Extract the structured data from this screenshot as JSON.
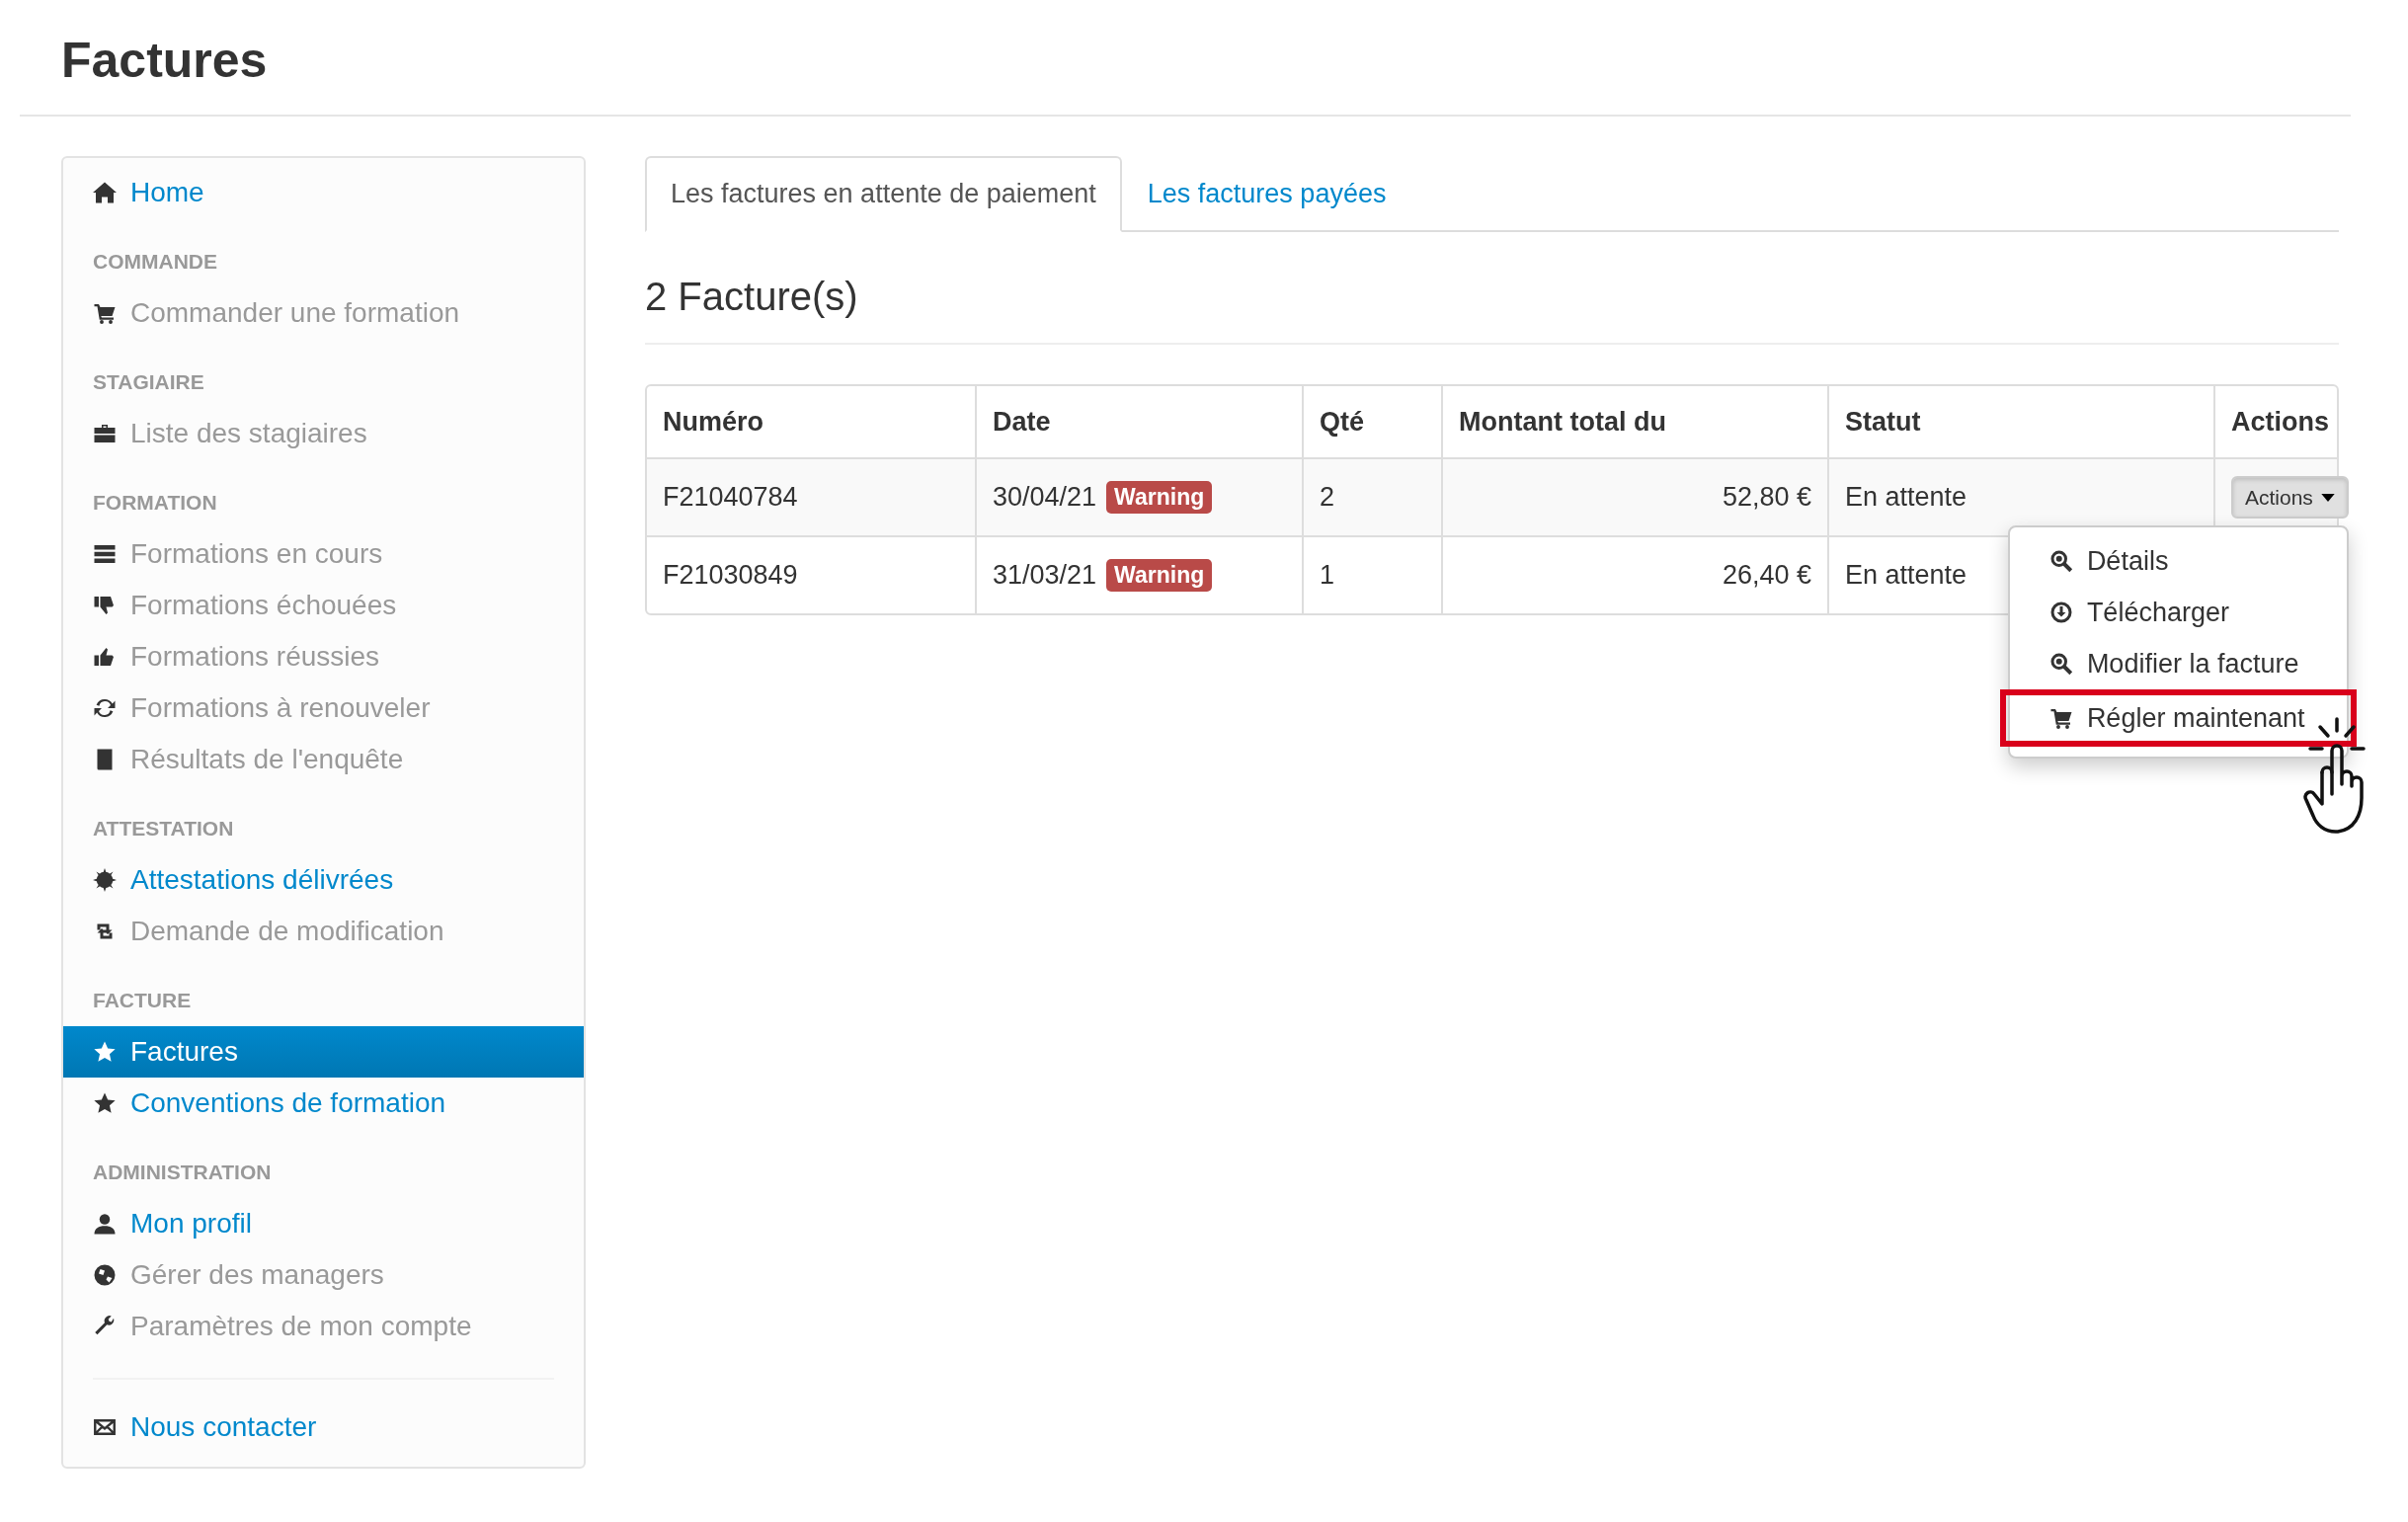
{
  "page": {
    "title": "Factures"
  },
  "sidebar": {
    "groups": [
      {
        "items": [
          {
            "label": "Home",
            "disabled": false,
            "selected": false
          }
        ]
      },
      {
        "heading": "COMMANDE",
        "items": [
          {
            "label": "Commander une formation",
            "disabled": true,
            "selected": false
          }
        ]
      },
      {
        "heading": "STAGIAIRE",
        "items": [
          {
            "label": "Liste des stagiaires",
            "disabled": true,
            "selected": false
          }
        ]
      },
      {
        "heading": "FORMATION",
        "items": [
          {
            "label": "Formations en cours",
            "disabled": true,
            "selected": false
          },
          {
            "label": "Formations échouées",
            "disabled": true,
            "selected": false
          },
          {
            "label": "Formations réussies",
            "disabled": true,
            "selected": false
          },
          {
            "label": "Formations à renouveler",
            "disabled": true,
            "selected": false
          },
          {
            "label": "Résultats de l'enquête",
            "disabled": true,
            "selected": false
          }
        ]
      },
      {
        "heading": "ATTESTATION",
        "items": [
          {
            "label": "Attestations délivrées",
            "disabled": false,
            "selected": false
          },
          {
            "label": "Demande de modification",
            "disabled": true,
            "selected": false
          }
        ]
      },
      {
        "heading": "FACTURE",
        "items": [
          {
            "label": "Factures",
            "disabled": false,
            "selected": true
          },
          {
            "label": "Conventions de formation",
            "disabled": false,
            "selected": false
          }
        ]
      },
      {
        "heading": "ADMINISTRATION",
        "items": [
          {
            "label": "Mon profil",
            "disabled": false,
            "selected": false
          },
          {
            "label": "Gérer des managers",
            "disabled": true,
            "selected": false
          },
          {
            "label": "Paramètres de mon compte",
            "disabled": true,
            "selected": false
          }
        ]
      },
      {
        "items": [
          {
            "label": "Nous contacter",
            "disabled": false,
            "selected": false
          }
        ]
      }
    ]
  },
  "tabs": [
    {
      "label": "Les factures en attente de paiement",
      "selected": true
    },
    {
      "label": "Les factures payées",
      "selected": false
    }
  ],
  "heading": "2 Facture(s)",
  "table": {
    "columns": [
      "Numéro",
      "Date",
      "Qté",
      "Montant total du",
      "Statut",
      "Actions"
    ],
    "rows": [
      {
        "cells": [
          "F21040784",
          "30/04/21",
          "2",
          "52,80 €",
          "En attente"
        ],
        "badge": "Warning",
        "actions": {
          "label": "Actions",
          "expanded": true,
          "menu": [
            {
              "label": "Détails",
              "highlighted": false
            },
            {
              "label": "Télécharger",
              "highlighted": false
            },
            {
              "label": "Modifier la facture",
              "highlighted": false
            },
            {
              "label": "Régler maintenant",
              "highlighted": true
            }
          ]
        }
      },
      {
        "cells": [
          "F21030849",
          "31/03/21",
          "1",
          "26,40 €",
          "En attente"
        ],
        "badge": "Warning"
      }
    ]
  }
}
